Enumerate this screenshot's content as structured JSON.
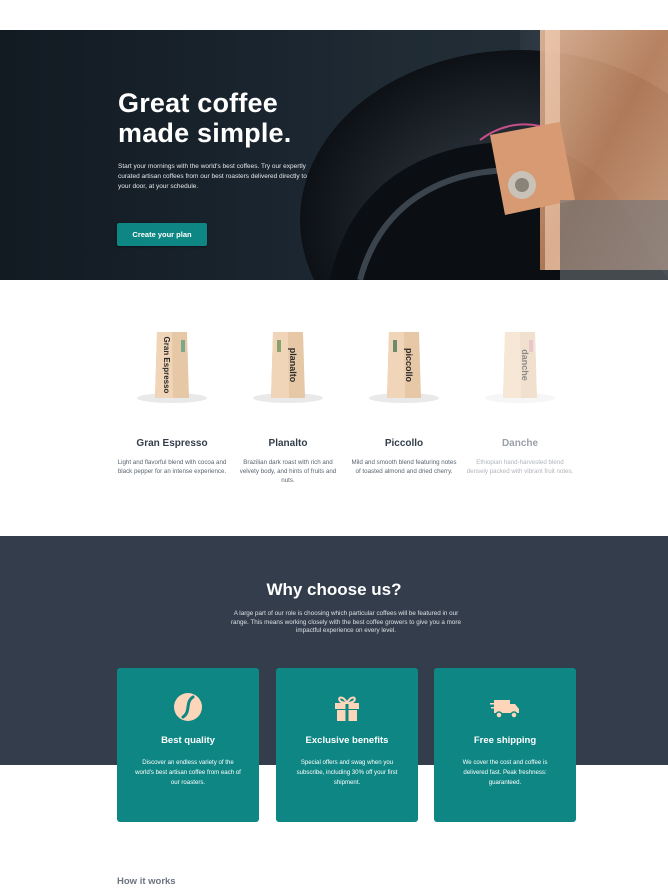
{
  "hero": {
    "title_line1": "Great coffee",
    "title_line2": "made simple.",
    "text": "Start your mornings with the world's best coffees. Try our expertly curated artisan coffees from our best roasters delivered directly to your door, at your schedule.",
    "cta": "Create your plan"
  },
  "products": [
    {
      "name": "Gran Espresso",
      "bag_label": "Gran Espresso",
      "desc": "Light and flavorful blend with cocoa and black pepper for an intense experience."
    },
    {
      "name": "Planalto",
      "bag_label": "planalto",
      "desc": "Brazilian dark roast with rich and velvety body, and hints of fruits and nuts."
    },
    {
      "name": "Piccollo",
      "bag_label": "piccollo",
      "desc": "Mild and smooth blend featuring notes of toasted almond and dried cherry."
    },
    {
      "name": "Danche",
      "bag_label": "danche",
      "desc": "Ethiopian hand-harvested blend densely packed with vibrant fruit notes."
    }
  ],
  "why": {
    "title": "Why choose us?",
    "text": "A large part of our role is choosing which particular coffees will be featured in our range. This means working closely with the best coffee growers to give you a more impactful experience on every level.",
    "cards": [
      {
        "icon": "coffee-bean-icon",
        "title": "Best quality",
        "text": "Discover an endless variety of the world's best artisan coffee from each of our roasters."
      },
      {
        "icon": "gift-icon",
        "title": "Exclusive benefits",
        "text": "Special offers and swag when you subscribe, including 30% off your first shipment."
      },
      {
        "icon": "truck-icon",
        "title": "Free shipping",
        "text": "We cover the cost and coffee is delivered fast. Peak freshness: guaranteed."
      }
    ]
  },
  "how": {
    "title": "How it works"
  },
  "colors": {
    "accent": "#0e8784",
    "dark": "#333d4b",
    "icon_fill": "#fdd6ba"
  }
}
